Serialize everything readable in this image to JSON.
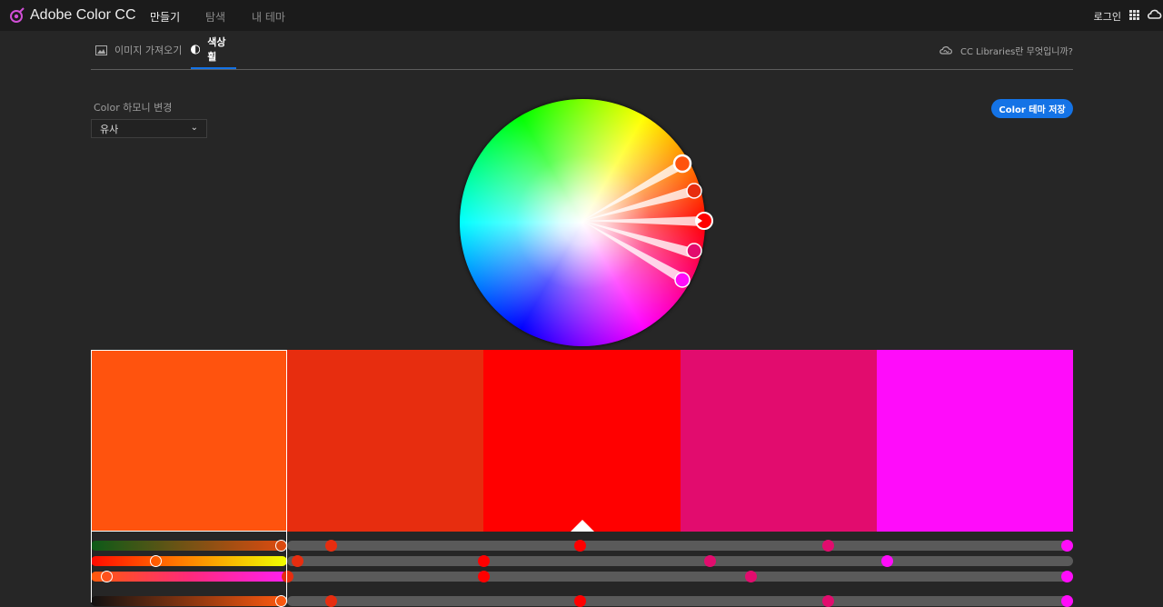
{
  "app": {
    "title": "Adobe Color CC"
  },
  "nav": {
    "items": [
      {
        "label": "만들기"
      },
      {
        "label": "탐색"
      },
      {
        "label": "내 테마"
      }
    ],
    "login": "로그인"
  },
  "subnav": {
    "tabs": [
      {
        "label": "이미지 가져오기",
        "icon": "image-icon"
      },
      {
        "label": "색상 휠",
        "icon": "color-wheel-icon"
      }
    ],
    "cc_link": "CC Libraries란 무엇입니까?"
  },
  "harmony": {
    "label": "Color 하모니 변경",
    "selected": "유사",
    "chevron": "⌄"
  },
  "save_button": {
    "label": "Color 테마 저장"
  },
  "colors": {
    "accent": "#1473e6"
  },
  "swatches": [
    {
      "hex": "#FF530E",
      "selected": true
    },
    {
      "hex": "#E72D0F",
      "selected": false
    },
    {
      "hex": "#FF0000",
      "selected": false,
      "base": true
    },
    {
      "hex": "#E20C6E",
      "selected": false
    },
    {
      "hex": "#FF0CFA",
      "selected": false
    }
  ],
  "slider_knobs": {
    "row1": [
      {
        "pos": 1.0
      },
      {
        "pos": 0.22
      },
      {
        "pos": 0.49
      },
      {
        "pos": 0.75
      },
      {
        "pos": 1.0
      }
    ],
    "row2": [
      {
        "pos": 0.33
      },
      {
        "pos": 0.05
      },
      {
        "pos": 0.0
      },
      {
        "pos": 0.15
      },
      {
        "pos": 0.05
      }
    ],
    "row3": [
      {
        "pos": 0.08
      },
      {
        "pos": 0.0
      },
      {
        "pos": 0.0
      },
      {
        "pos": 0.36
      },
      {
        "pos": 1.0
      }
    ],
    "row4": [
      {
        "pos": 1.0
      },
      {
        "pos": 0.22
      },
      {
        "pos": 0.49
      },
      {
        "pos": 0.75
      },
      {
        "pos": 1.0
      }
    ]
  }
}
